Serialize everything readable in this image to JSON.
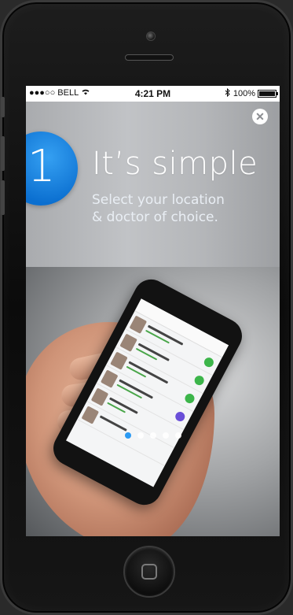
{
  "status_bar": {
    "carrier": "●●●○○ BELL",
    "wifi_icon": "wifi-icon",
    "time": "4:21 PM",
    "bluetooth_icon": "bluetooth-icon",
    "battery": "100%"
  },
  "onboarding": {
    "step_number": "1",
    "headline": "It’s simple",
    "subtitle_line1": "Select your location",
    "subtitle_line2": "& doctor of choice.",
    "close_glyph": "✕",
    "accent_color": "#1a85e6"
  },
  "pagination": {
    "total": 5,
    "active_index": 0
  }
}
